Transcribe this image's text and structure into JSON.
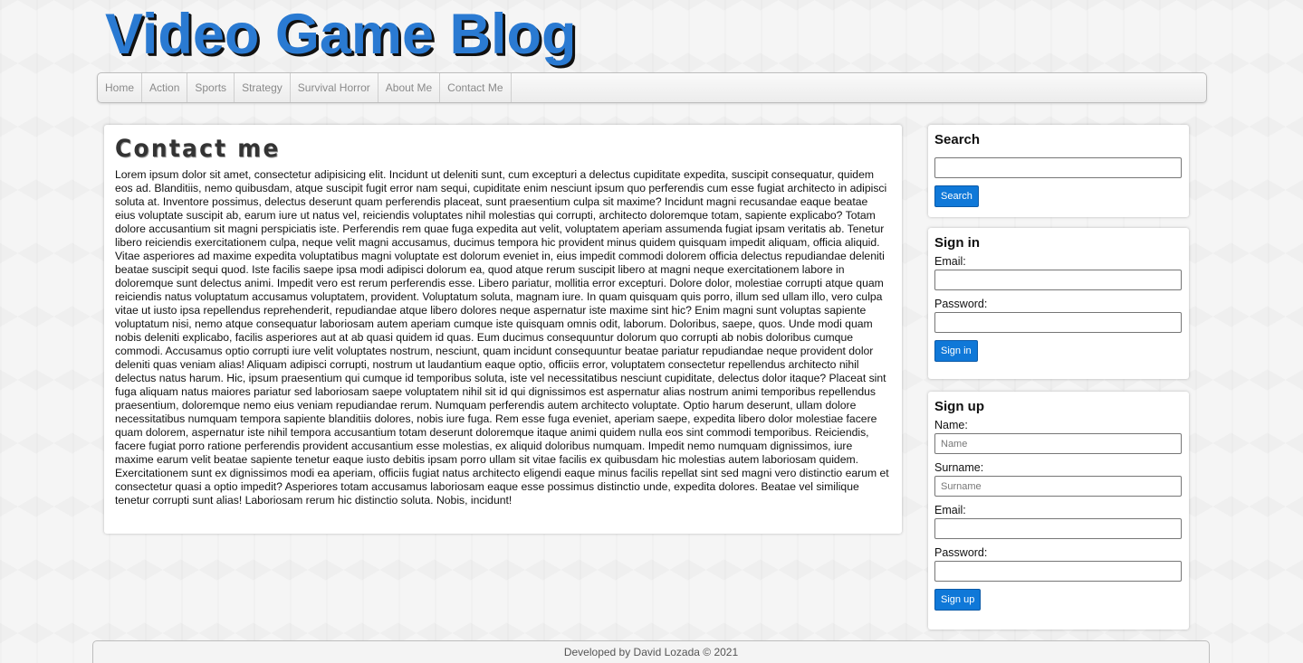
{
  "header": {
    "title": "Video Game Blog"
  },
  "nav": {
    "items": [
      {
        "label": "Home"
      },
      {
        "label": "Action"
      },
      {
        "label": "Sports"
      },
      {
        "label": "Strategy"
      },
      {
        "label": "Survival Horror"
      },
      {
        "label": "About Me"
      },
      {
        "label": "Contact Me"
      }
    ]
  },
  "main": {
    "heading": "Contact me",
    "body": "Lorem ipsum dolor sit amet, consectetur adipisicing elit. Incidunt ut deleniti sunt, cum excepturi a delectus cupiditate expedita, suscipit consequatur, quidem eos ad. Blanditiis, nemo quibusdam, atque suscipit fugit error nam sequi, cupiditate enim nesciunt ipsum quo perferendis cum esse fugiat architecto in adipisci soluta at. Inventore possimus, delectus deserunt quam perferendis placeat, sunt praesentium culpa sit maxime? Incidunt magni recusandae eaque beatae eius voluptate suscipit ab, earum iure ut natus vel, reiciendis voluptates nihil molestias qui corrupti, architecto doloremque totam, sapiente explicabo? Totam dolore accusantium sit magni perspiciatis iste. Perferendis rem quae fuga expedita aut velit, voluptatem aperiam assumenda fugiat ipsam veritatis ab. Tenetur libero reiciendis exercitationem culpa, neque velit magni accusamus, ducimus tempora hic provident minus quidem quisquam impedit aliquam, officia aliquid. Vitae asperiores ad maxime expedita voluptatibus magni voluptate est dolorum eveniet in, eius impedit commodi dolorem officia delectus repudiandae deleniti beatae suscipit sequi quod. Iste facilis saepe ipsa modi adipisci dolorum ea, quod atque rerum suscipit libero at magni neque exercitationem labore in doloremque sunt delectus animi. Impedit vero est rerum perferendis esse. Libero pariatur, mollitia error excepturi. Dolore dolor, molestiae corrupti atque quam reiciendis natus voluptatum accusamus voluptatem, provident. Voluptatum soluta, magnam iure. In quam quisquam quis porro, illum sed ullam illo, vero culpa vitae ut iusto ipsa repellendus reprehenderit, repudiandae atque libero dolores neque aspernatur iste maxime sint hic? Enim magni sunt voluptas sapiente voluptatum nisi, nemo atque consequatur laboriosam autem aperiam cumque iste quisquam omnis odit, laborum. Doloribus, saepe, quos. Unde modi quam nobis deleniti explicabo, facilis asperiores aut at ab quasi quidem id quas. Eum ducimus consequuntur dolorum quo corrupti ab nobis doloribus cumque commodi. Accusamus optio corrupti iure velit voluptates nostrum, nesciunt, quam incidunt consequuntur beatae pariatur repudiandae neque provident dolor deleniti quas veniam alias! Aliquam adipisci corrupti, nostrum ut laudantium eaque optio, officiis error, voluptatem consectetur repellendus architecto nihil delectus natus harum. Hic, ipsum praesentium qui cumque id temporibus soluta, iste vel necessitatibus nesciunt cupiditate, delectus dolor itaque? Placeat sint fuga aliquam natus maiores pariatur sed laboriosam saepe voluptatem nihil sit id qui dignissimos est aspernatur alias nostrum animi temporibus repellendus praesentium, doloremque nemo eius veniam repudiandae rerum. Numquam perferendis autem architecto voluptate. Optio harum deserunt, ullam dolore necessitatibus numquam tempora sapiente blanditiis dolores, nobis iure fuga. Rem esse fuga eveniet, aperiam saepe, expedita libero dolor molestiae facere quam dolorem, aspernatur iste nihil tempora accusantium totam deserunt doloremque itaque animi quidem nulla eos sint commodi temporibus. Reiciendis, facere fugiat porro ratione perferendis provident accusantium esse molestias, ex aliquid doloribus numquam. Impedit nemo numquam dignissimos, iure maxime earum velit beatae sapiente tenetur eaque iusto debitis ipsam porro ullam sit vitae facilis ex quibusdam hic molestias autem laboriosam quidem. Exercitationem sunt ex dignissimos modi ea aperiam, officiis fugiat natus architecto eligendi eaque minus facilis repellat sint sed magni vero distinctio earum et consectetur quasi a optio impedit? Asperiores totam accusamus laboriosam eaque esse possimus distinctio unde, expedita dolores. Beatae vel similique tenetur corrupti sunt alias! Laboriosam rerum hic distinctio soluta. Nobis, incidunt!"
  },
  "sidebar": {
    "search": {
      "title": "Search",
      "input_value": "",
      "button_label": "Search"
    },
    "signin": {
      "title": "Sign in",
      "email_label": "Email:",
      "password_label": "Password:",
      "button_label": "Sign in"
    },
    "signup": {
      "title": "Sign up",
      "name_label": "Name:",
      "name_placeholder": "Name",
      "surname_label": "Surname:",
      "surname_placeholder": "Surname",
      "email_label": "Email:",
      "password_label": "Password:",
      "button_label": "Sign up"
    }
  },
  "footer": {
    "text": "Developed by David Lozada © 2021"
  },
  "colors": {
    "title": "#2a7ad2",
    "button": "#0f78d8"
  }
}
